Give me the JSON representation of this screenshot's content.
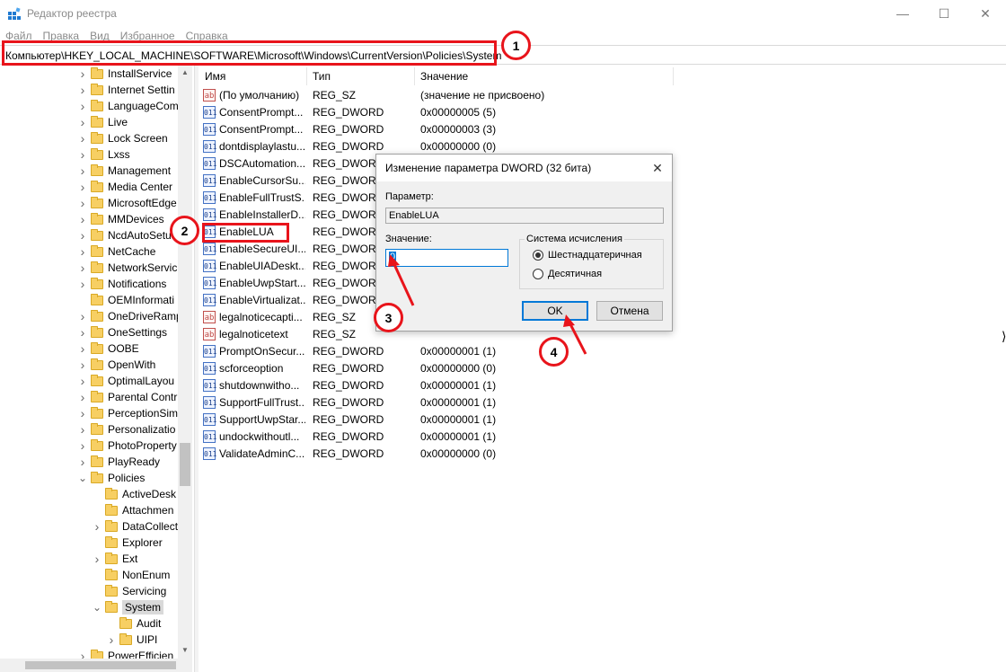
{
  "window": {
    "title": "Редактор реестра",
    "minimize_glyph": "—",
    "maximize_glyph": "☐",
    "close_glyph": "✕"
  },
  "menu": [
    "Файл",
    "Правка",
    "Вид",
    "Избранное",
    "Справка"
  ],
  "address": "Компьютер\\HKEY_LOCAL_MACHINE\\SOFTWARE\\Microsoft\\Windows\\CurrentVersion\\Policies\\System",
  "tree": [
    {
      "label": "InstallService",
      "level": 0,
      "expander": "closed"
    },
    {
      "label": "Internet Settin",
      "level": 0,
      "expander": "closed"
    },
    {
      "label": "LanguageCom",
      "level": 0,
      "expander": "closed"
    },
    {
      "label": "Live",
      "level": 0,
      "expander": "closed"
    },
    {
      "label": "Lock Screen",
      "level": 0,
      "expander": "closed"
    },
    {
      "label": "Lxss",
      "level": 0,
      "expander": "closed"
    },
    {
      "label": "Management",
      "level": 0,
      "expander": "closed"
    },
    {
      "label": "Media Center",
      "level": 0,
      "expander": "closed"
    },
    {
      "label": "MicrosoftEdge",
      "level": 0,
      "expander": "closed"
    },
    {
      "label": "MMDevices",
      "level": 0,
      "expander": "closed"
    },
    {
      "label": "NcdAutoSetu",
      "level": 0,
      "expander": "closed"
    },
    {
      "label": "NetCache",
      "level": 0,
      "expander": "closed"
    },
    {
      "label": "NetworkServic",
      "level": 0,
      "expander": "closed"
    },
    {
      "label": "Notifications",
      "level": 0,
      "expander": "closed"
    },
    {
      "label": "OEMInformati",
      "level": 0,
      "expander": "none"
    },
    {
      "label": "OneDriveRamp",
      "level": 0,
      "expander": "closed"
    },
    {
      "label": "OneSettings",
      "level": 0,
      "expander": "closed"
    },
    {
      "label": "OOBE",
      "level": 0,
      "expander": "closed"
    },
    {
      "label": "OpenWith",
      "level": 0,
      "expander": "closed"
    },
    {
      "label": "OptimalLayou",
      "level": 0,
      "expander": "closed"
    },
    {
      "label": "Parental Contr",
      "level": 0,
      "expander": "closed"
    },
    {
      "label": "PerceptionSim",
      "level": 0,
      "expander": "closed"
    },
    {
      "label": "Personalizatio",
      "level": 0,
      "expander": "closed"
    },
    {
      "label": "PhotoProperty",
      "level": 0,
      "expander": "closed"
    },
    {
      "label": "PlayReady",
      "level": 0,
      "expander": "closed"
    },
    {
      "label": "Policies",
      "level": 0,
      "expander": "open"
    },
    {
      "label": "ActiveDesk",
      "level": 1,
      "expander": "none"
    },
    {
      "label": "Attachmen",
      "level": 1,
      "expander": "none"
    },
    {
      "label": "DataCollect",
      "level": 1,
      "expander": "closed"
    },
    {
      "label": "Explorer",
      "level": 1,
      "expander": "none"
    },
    {
      "label": "Ext",
      "level": 1,
      "expander": "closed"
    },
    {
      "label": "NonEnum",
      "level": 1,
      "expander": "none"
    },
    {
      "label": "Servicing",
      "level": 1,
      "expander": "none"
    },
    {
      "label": "System",
      "level": 1,
      "expander": "open",
      "selected": true
    },
    {
      "label": "Audit",
      "level": 2,
      "expander": "none"
    },
    {
      "label": "UIPI",
      "level": 2,
      "expander": "closed"
    },
    {
      "label": "PowerEfficien",
      "level": 0,
      "expander": "closed"
    }
  ],
  "columns": [
    "Имя",
    "Тип",
    "Значение"
  ],
  "values": [
    {
      "icon": "ab",
      "name": "(По умолчанию)",
      "type": "REG_SZ",
      "data": "(значение не присвоено)"
    },
    {
      "icon": "dw",
      "name": "ConsentPrompt...",
      "type": "REG_DWORD",
      "data": "0x00000005 (5)"
    },
    {
      "icon": "dw",
      "name": "ConsentPrompt...",
      "type": "REG_DWORD",
      "data": "0x00000003 (3)"
    },
    {
      "icon": "dw",
      "name": "dontdisplaylastu...",
      "type": "REG_DWORD",
      "data": "0x00000000 (0)"
    },
    {
      "icon": "dw",
      "name": "DSCAutomation...",
      "type": "REG_DWORD",
      "data": ""
    },
    {
      "icon": "dw",
      "name": "EnableCursorSu...",
      "type": "REG_DWORD",
      "data": ""
    },
    {
      "icon": "dw",
      "name": "EnableFullTrustS...",
      "type": "REG_DWORD",
      "data": ""
    },
    {
      "icon": "dw",
      "name": "EnableInstallerD...",
      "type": "REG_DWORD",
      "data": ""
    },
    {
      "icon": "dw",
      "name": "EnableLUA",
      "type": "REG_DWORD",
      "data": ""
    },
    {
      "icon": "dw",
      "name": "EnableSecureUI...",
      "type": "REG_DWORD",
      "data": ""
    },
    {
      "icon": "dw",
      "name": "EnableUIADeskt...",
      "type": "REG_DWORD",
      "data": ""
    },
    {
      "icon": "dw",
      "name": "EnableUwpStart...",
      "type": "REG_DWORD",
      "data": ""
    },
    {
      "icon": "dw",
      "name": "EnableVirtualizat...",
      "type": "REG_DWORD",
      "data": ""
    },
    {
      "icon": "ab",
      "name": "legalnoticecapti...",
      "type": "REG_SZ",
      "data": ""
    },
    {
      "icon": "ab",
      "name": "legalnoticetext",
      "type": "REG_SZ",
      "data": ""
    },
    {
      "icon": "dw",
      "name": "PromptOnSecur...",
      "type": "REG_DWORD",
      "data": "0x00000001 (1)"
    },
    {
      "icon": "dw",
      "name": "scforceoption",
      "type": "REG_DWORD",
      "data": "0x00000000 (0)"
    },
    {
      "icon": "dw",
      "name": "shutdownwitho...",
      "type": "REG_DWORD",
      "data": "0x00000001 (1)"
    },
    {
      "icon": "dw",
      "name": "SupportFullTrust...",
      "type": "REG_DWORD",
      "data": "0x00000001 (1)"
    },
    {
      "icon": "dw",
      "name": "SupportUwpStar...",
      "type": "REG_DWORD",
      "data": "0x00000001 (1)"
    },
    {
      "icon": "dw",
      "name": "undockwithoutl...",
      "type": "REG_DWORD",
      "data": "0x00000001 (1)"
    },
    {
      "icon": "dw",
      "name": "ValidateAdminC...",
      "type": "REG_DWORD",
      "data": "0x00000000 (0)"
    }
  ],
  "dialog": {
    "title": "Изменение параметра DWORD (32 бита)",
    "close_glyph": "✕",
    "param_label": "Параметр:",
    "param_value": "EnableLUA",
    "value_label": "Значение:",
    "value": "0",
    "base_group": "Система исчисления",
    "radio_hex": "Шестнадцатеричная",
    "radio_dec": "Десятичная",
    "base_selected": "hex",
    "ok": "OK",
    "cancel": "Отмена"
  },
  "annotations": {
    "steps": [
      "1",
      "2",
      "3",
      "4"
    ],
    "color": "#e8141b"
  },
  "scroll_glyphs": {
    "up": "▲",
    "down": "▼",
    "left": "◀",
    "right": "▶"
  }
}
